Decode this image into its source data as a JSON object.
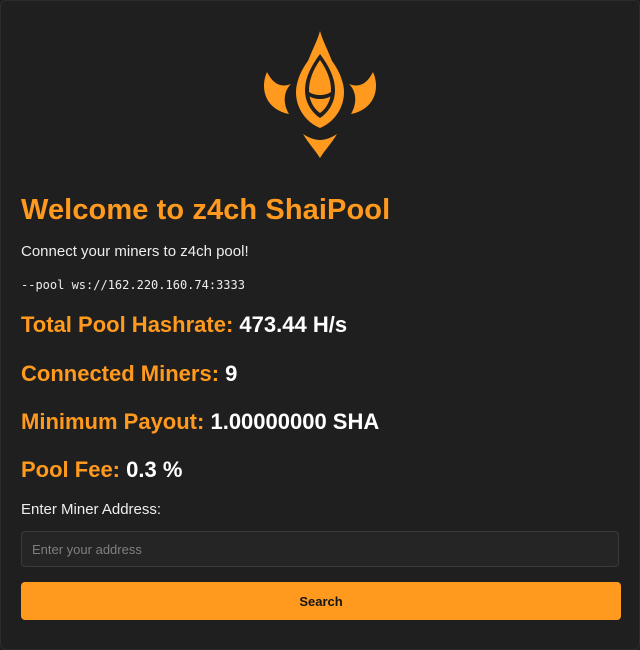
{
  "colors": {
    "accent": "#ff9a1f",
    "background": "#1f1f1f",
    "text": "#ededed",
    "value": "#ffffff"
  },
  "logo": {
    "icon": "shai-flame-horns-logo"
  },
  "title": "Welcome to z4ch ShaiPool",
  "intro": "Connect your miners to z4ch pool!",
  "pool_command": "--pool ws://162.220.160.74:3333",
  "stats": {
    "hashrate": {
      "label": "Total Pool Hashrate:",
      "value": "473.44 H/s"
    },
    "miners": {
      "label": "Connected Miners:",
      "value": "9"
    },
    "payout": {
      "label": "Minimum Payout:",
      "value": "1.00000000 SHA"
    },
    "fee": {
      "label": "Pool Fee:",
      "value": "0.3 %"
    }
  },
  "search": {
    "label": "Enter Miner Address:",
    "placeholder": "Enter your address",
    "value": "",
    "button_label": "Search"
  }
}
